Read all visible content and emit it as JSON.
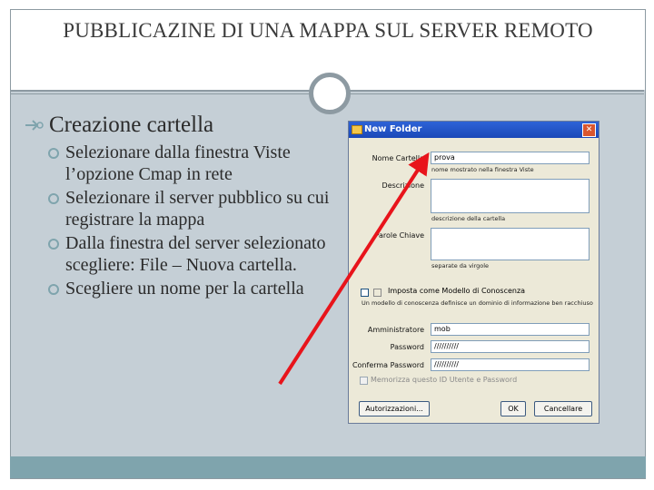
{
  "slide": {
    "title": "PUBBLICAZINE DI UNA MAPPA  SUL SERVER REMOTO",
    "heading": "Creazione cartella",
    "bullets": [
      "Selezionare dalla finestra Viste l’opzione Cmap in rete",
      "Selezionare il server pubblico su cui registrare la mappa",
      "Dalla finestra del server selezionato scegliere: File – Nuova cartella.",
      "Scegliere un nome per la cartella"
    ]
  },
  "dialog": {
    "title": "New Folder",
    "close": "✕",
    "name_label": "Nome Cartella",
    "name_value": "prova",
    "name_hint": "nome mostrato nella finestra Viste",
    "description_label": "Descrizione",
    "description_value": "",
    "description_hint": "descrizione della cartella",
    "keywords_label": "Parole Chiave",
    "keywords_value": "",
    "keywords_hint": "separate da virgole",
    "knowledge_model_label": "Imposta come Modello di Conoscenza",
    "knowledge_model_hint": "Un modello di conoscenza definisce un dominio di informazione ben racchiuso",
    "admin_label": "Amministratore",
    "admin_value": "mob",
    "password_label": "Password",
    "password_value": "//////////",
    "confirm_password_label": "Conferma Password",
    "confirm_password_value": "//////////",
    "remember_label": "Memorizza questo ID Utente e Password",
    "permissions_button": "Autorizzazioni...",
    "ok_button": "OK",
    "cancel_button": "Cancellare"
  },
  "colors": {
    "arrow": "#e8141b",
    "accent": "#7fa4ad",
    "frame": "#8d9aa2"
  }
}
